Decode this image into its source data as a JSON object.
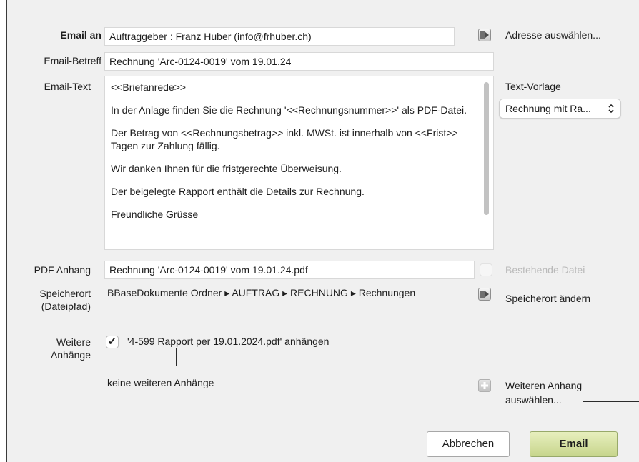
{
  "form": {
    "email_to_label": "Email an",
    "email_to_value": "Auftraggeber : Franz Huber  (info@frhuber.ch)",
    "address_select_label": "Adresse auswählen...",
    "subject_label": "Email-Betreff",
    "subject_value": "Rechnung 'Arc-0124-0019' vom 19.01.24",
    "text_label": "Email-Text",
    "text_paragraphs": [
      "<<Briefanrede>>",
      "In der Anlage finden Sie die Rechnung '<<Rechnungsnummer>>' als PDF-Datei.",
      "Der Betrag von <<Rechnungsbetrag>> inkl. MWSt. ist innerhalb von <<Frist>> Tagen zur Zahlung fällig.",
      "Wir danken Ihnen für die fristgerechte Überweisung.",
      "Der beigelegte Rapport enthält die Details zur Rechnung.",
      "Freundliche Grüsse"
    ],
    "template_label": "Text-Vorlage",
    "template_value": "Rechnung mit Ra...",
    "pdf_label": "PDF Anhang",
    "pdf_value": "Rechnung 'Arc-0124-0019' vom 19.01.24.pdf",
    "existing_file_label": "Bestehende Datei",
    "location_label_line1": "Speicherort",
    "location_label_line2": "(Dateipfad)",
    "location_value": "BBaseDokumente Ordner ▸ AUFTRAG ▸ RECHNUNG ▸ Rechnungen",
    "change_location_label": "Speicherort ändern",
    "more_attachments_line1": "Weitere",
    "more_attachments_line2": "Anhänge",
    "attach_report_label": "'4-599 Rapport per 19.01.2024.pdf' anhängen",
    "attach_report_checked": "✓",
    "no_more_attachments": "keine weiteren Anhänge",
    "add_attachment_line1": "Weiteren Anhang",
    "add_attachment_line2": "auswählen..."
  },
  "buttons": {
    "cancel": "Abbrechen",
    "email": "Email"
  },
  "icons": {
    "picker": "address-book-picker-icon",
    "add": "plus-icon",
    "chevron": "up-down-chevron-icon"
  },
  "colors": {
    "dialog_bg": "#f0f0f0",
    "accent_green": "#c7d58c",
    "divider": "#a9bf63"
  }
}
